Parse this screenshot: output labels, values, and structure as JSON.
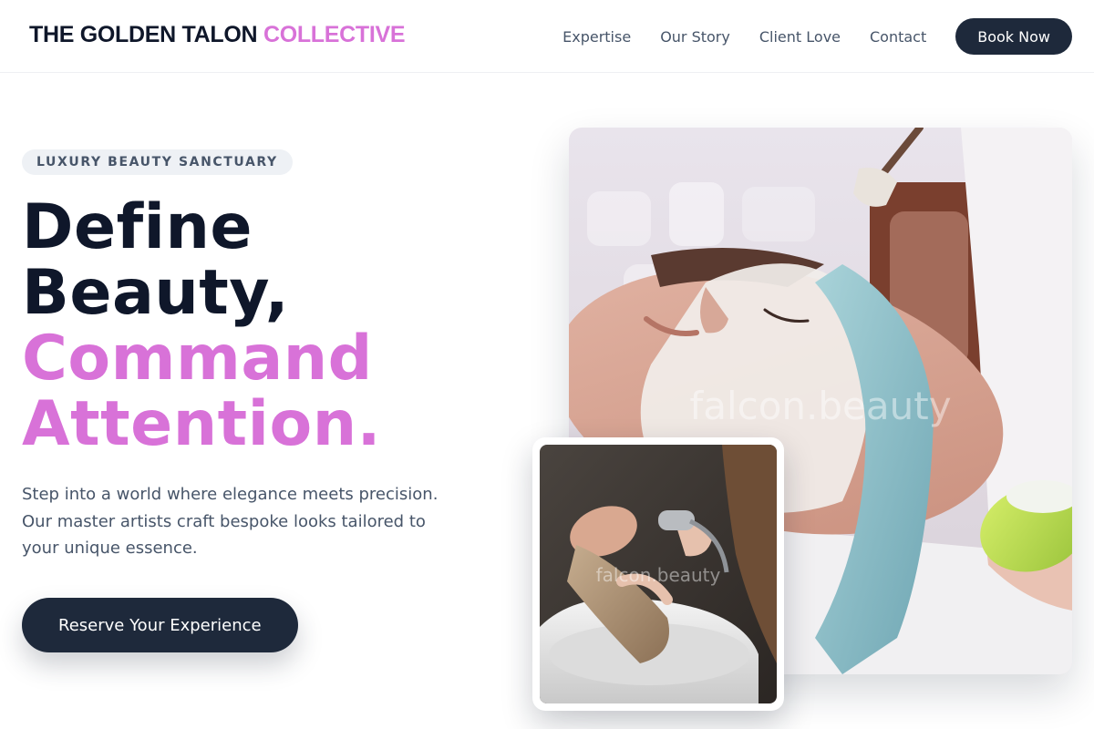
{
  "brand": {
    "name_main": "THE GOLDEN TALON",
    "name_accent": "COLLECTIVE",
    "accent_color": "#d872d8",
    "primary_color": "#1e293b"
  },
  "nav": {
    "links": [
      "Expertise",
      "Our Story",
      "Client Love",
      "Contact"
    ],
    "book_label": "Book Now"
  },
  "hero": {
    "badge": "LUXURY BEAUTY SANCTUARY",
    "headline_dark": [
      "Define",
      "Beauty,"
    ],
    "headline_accent": [
      "Command",
      "Attention."
    ],
    "description": "Step into a world where elegance meets precision. Our master artists craft bespoke looks tailored to your unique essence.",
    "cta_label": "Reserve Your Experience"
  },
  "images": {
    "main_watermark": "falcon.beauty",
    "inset_watermark": "falcon.beauty"
  }
}
